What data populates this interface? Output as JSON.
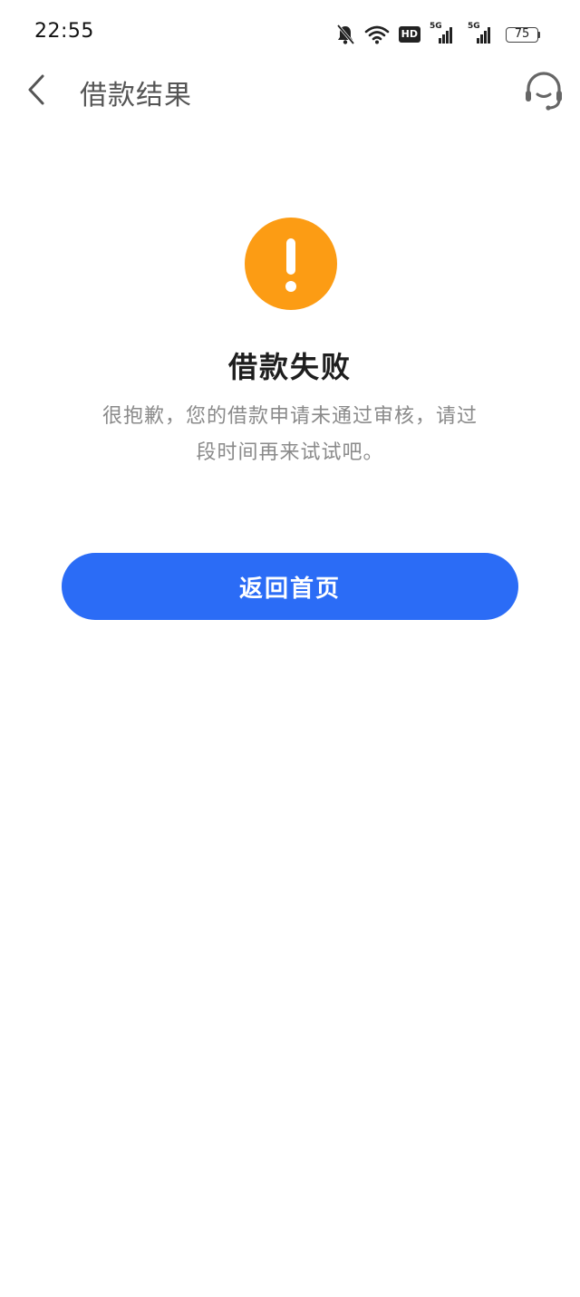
{
  "status_bar": {
    "time": "22:55",
    "icons": [
      "bell-off-icon",
      "wifi-icon",
      "hd-icon",
      "signal-5g-icon",
      "signal-5g-icon",
      "battery-icon"
    ],
    "hd_label": "HD",
    "net_label_1": "5G",
    "net_label_2": "5G",
    "battery_level": "75"
  },
  "nav": {
    "back_icon": "chevron-left-icon",
    "title": "借款结果",
    "service_icon": "customer-service-headset-icon"
  },
  "result": {
    "icon": "exclamation-circle-icon",
    "icon_color": "#fc9c14",
    "title": "借款失败",
    "description": "很抱歉，您的借款申请未通过审核，请过段时间再来试试吧。"
  },
  "actions": {
    "home_button_label": "返回首页",
    "home_button_color": "#2b6cf6"
  }
}
